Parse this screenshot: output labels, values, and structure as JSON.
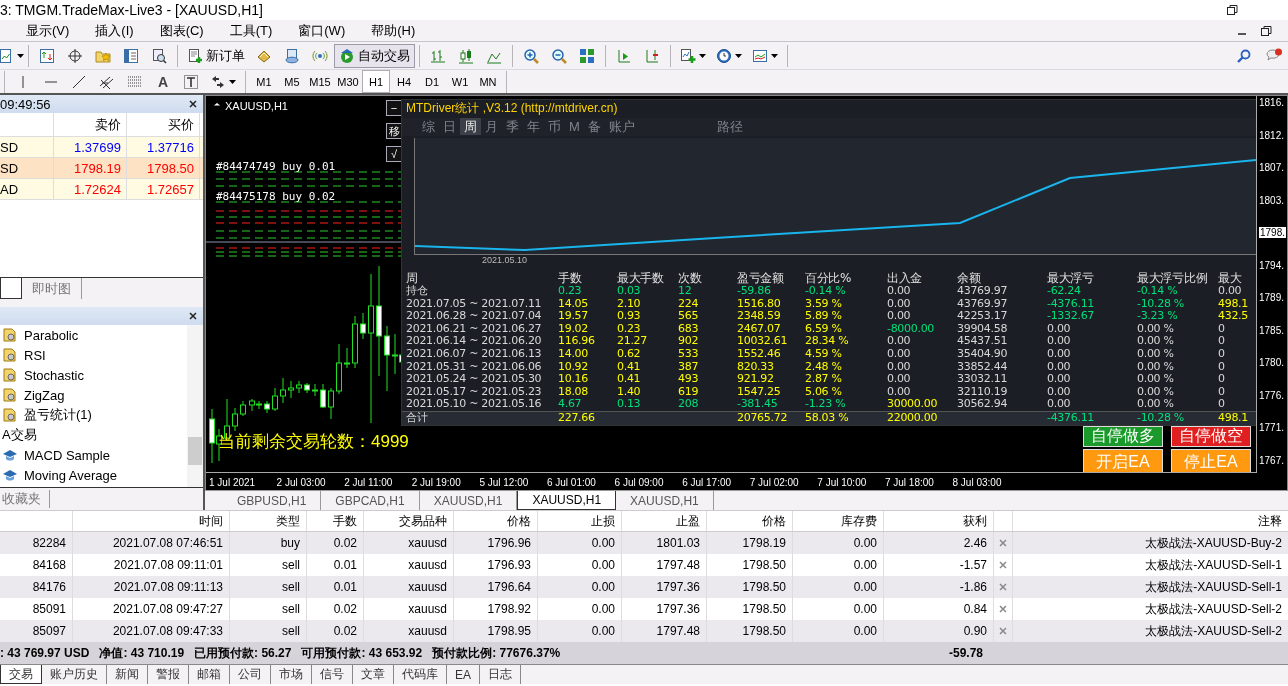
{
  "window": {
    "title": "3: TMGM.TradeMax-Live3 - [XAUUSD,H1]"
  },
  "menu": [
    "显示(V)",
    "插入(I)",
    "图表(C)",
    "工具(T)",
    "窗口(W)",
    "帮助(H)"
  ],
  "toolbar": {
    "buttons": [
      {
        "label": "新订单",
        "on": false
      },
      {
        "label": "自动交易",
        "on": true
      }
    ]
  },
  "drawing_toolbar": {
    "text_tool": "A",
    "timeframes": [
      {
        "label": "M1",
        "selected": false
      },
      {
        "label": "M5",
        "selected": false
      },
      {
        "label": "M15",
        "selected": false
      },
      {
        "label": "M30",
        "selected": false
      },
      {
        "label": "H1",
        "selected": true
      },
      {
        "label": "H4",
        "selected": false
      },
      {
        "label": "D1",
        "selected": false
      },
      {
        "label": "W1",
        "selected": false
      },
      {
        "label": "MN",
        "selected": false
      }
    ]
  },
  "market_watch": {
    "time": "09:49:56",
    "columns": [
      "卖价",
      "买价"
    ],
    "rows": [
      {
        "symbol": "SD",
        "bid": "1.37699",
        "ask": "1.37716",
        "color": "#0000ff",
        "selected": false
      },
      {
        "symbol": "SD",
        "bid": "1798.19",
        "ask": "1798.50",
        "color": "#ff0000",
        "selected": true
      },
      {
        "symbol": "AD",
        "bid": "1.72624",
        "ask": "1.72657",
        "color": "#ff0000",
        "selected": false
      }
    ],
    "tabs": [
      {
        "selected": true
      },
      {
        "label": "即时图",
        "selected": false
      }
    ]
  },
  "navigator": {
    "items": [
      {
        "label": "Parabolic",
        "kind": "indicator"
      },
      {
        "label": "RSI",
        "kind": "indicator"
      },
      {
        "label": "Stochastic",
        "kind": "indicator"
      },
      {
        "label": "ZigZag",
        "kind": "indicator"
      },
      {
        "label": "盈亏统计(1)",
        "kind": "indicator"
      },
      {
        "label": "A交易",
        "kind": "folder",
        "children": [
          {
            "label": "MACD Sample",
            "kind": "expert"
          },
          {
            "label": "Moving Average",
            "kind": "expert"
          }
        ]
      }
    ],
    "bottom_tab": "收藏夹"
  },
  "chart": {
    "symbol": "XAUUSD,H1",
    "side_buttons": [
      "−",
      "移",
      "√"
    ],
    "order_labels": [
      "#84474749 buy 0.01",
      "#84475178 buy 0.02"
    ],
    "rounds_text": "当前剩余交易轮数：4999",
    "ea_buttons": [
      {
        "label": "自停做多",
        "kind": "long"
      },
      {
        "label": "自停做空",
        "kind": "short"
      },
      {
        "label": "开启EA",
        "kind": "start"
      },
      {
        "label": "停止EA",
        "kind": "stop"
      }
    ],
    "time_axis": [
      "1 Jul 2021",
      "2 Jul 03:00",
      "2 Jul 11:00",
      "2 Jul 19:00",
      "5 Jul 12:00",
      "6 Jul 01:00",
      "6 Jul 09:00",
      "6 Jul 17:00",
      "7 Jul 02:00",
      "7 Jul 10:00",
      "7 Jul 18:00",
      "8 Jul 03:00"
    ],
    "price_axis": [
      {
        "text": "1816.",
        "highlighted": false
      },
      {
        "text": "1812.",
        "highlighted": false
      },
      {
        "text": "1807.",
        "highlighted": false
      },
      {
        "text": "1803.",
        "highlighted": false
      },
      {
        "text": "1798.",
        "highlighted": true
      },
      {
        "text": "1794.",
        "highlighted": false
      },
      {
        "text": "1789.",
        "highlighted": false
      },
      {
        "text": "1785.",
        "highlighted": false
      },
      {
        "text": "1780.",
        "highlighted": false
      },
      {
        "text": "1776.",
        "highlighted": false
      },
      {
        "text": "1771.",
        "highlighted": false
      },
      {
        "text": "1767.",
        "highlighted": false
      }
    ],
    "stats_panel": {
      "title": "MTDriver统计 ,V3.12 (http://mtdriver.cn)",
      "tabs": [
        {
          "label": "综",
          "selected": false
        },
        {
          "label": "日",
          "selected": false
        },
        {
          "label": "周",
          "selected": true
        },
        {
          "label": "月",
          "selected": false
        },
        {
          "label": "季",
          "selected": false
        },
        {
          "label": "年",
          "selected": false
        },
        {
          "label": "币",
          "selected": false
        },
        {
          "label": "M",
          "selected": false
        },
        {
          "label": "备",
          "selected": false
        },
        {
          "label": "账户",
          "selected": false
        },
        {
          "label": "路径",
          "selected": false
        }
      ],
      "equity_chart": {
        "date_label": "2021.05.10"
      },
      "columns": [
        "周",
        "手数",
        "最大手数",
        "次数",
        "盈亏金额",
        "百分比%",
        "出入金",
        "余额",
        "最大浮亏",
        "最大浮亏比例",
        "最大"
      ],
      "rows": [
        {
          "cells": [
            {
              "text": "持仓"
            },
            {
              "text": "0.23",
              "color": "#00e07a"
            },
            {
              "text": "0.03",
              "color": "#00e07a"
            },
            {
              "text": "12",
              "color": "#00e07a"
            },
            {
              "text": "-59.86",
              "color": "#00e07a"
            },
            {
              "text": "-0.14 %",
              "color": "#00e07a"
            },
            {
              "text": "0.00",
              "color": "#d8d8d8"
            },
            {
              "text": "43769.97",
              "color": "#d8d8d8"
            },
            {
              "text": "-62.24",
              "color": "#00e07a"
            },
            {
              "text": "-0.14 %",
              "color": "#00e07a"
            },
            {
              "text": "0.00",
              "color": "#d8d8d8"
            }
          ]
        },
        {
          "cells": [
            {
              "text": "2021.07.05 ~ 2021.07.11",
              "color": "#d8d8d8"
            },
            {
              "text": "14.05",
              "color": "#ffff00"
            },
            {
              "text": "2.10",
              "color": "#ffff00"
            },
            {
              "text": "224",
              "color": "#ffff00"
            },
            {
              "text": "1516.80",
              "color": "#ffff00"
            },
            {
              "text": "3.59 %",
              "color": "#ffff00"
            },
            {
              "text": "0.00",
              "color": "#d8d8d8"
            },
            {
              "text": "43769.97",
              "color": "#d8d8d8"
            },
            {
              "text": "-4376.11",
              "color": "#00e07a"
            },
            {
              "text": "-10.28 %",
              "color": "#00e07a"
            },
            {
              "text": "498.1",
              "color": "#ffff00"
            }
          ]
        },
        {
          "cells": [
            {
              "text": "2021.06.28 ~ 2021.07.04",
              "color": "#d8d8d8"
            },
            {
              "text": "19.57",
              "color": "#ffff00"
            },
            {
              "text": "0.93",
              "color": "#ffff00"
            },
            {
              "text": "565",
              "color": "#ffff00"
            },
            {
              "text": "2348.59",
              "color": "#ffff00"
            },
            {
              "text": "5.89 %",
              "color": "#ffff00"
            },
            {
              "text": "0.00",
              "color": "#d8d8d8"
            },
            {
              "text": "42253.17",
              "color": "#d8d8d8"
            },
            {
              "text": "-1332.67",
              "color": "#00e07a"
            },
            {
              "text": "-3.23 %",
              "color": "#00e07a"
            },
            {
              "text": "432.5",
              "color": "#ffff00"
            }
          ]
        },
        {
          "cells": [
            {
              "text": "2021.06.21 ~ 2021.06.27",
              "color": "#d8d8d8"
            },
            {
              "text": "19.02",
              "color": "#ffff00"
            },
            {
              "text": "0.23",
              "color": "#ffff00"
            },
            {
              "text": "683",
              "color": "#ffff00"
            },
            {
              "text": "2467.07",
              "color": "#ffff00"
            },
            {
              "text": "6.59 %",
              "color": "#ffff00"
            },
            {
              "text": "-8000.00",
              "color": "#00e07a"
            },
            {
              "text": "39904.58",
              "color": "#d8d8d8"
            },
            {
              "text": "0.00",
              "color": "#d8d8d8"
            },
            {
              "text": "0.00 %",
              "color": "#d8d8d8"
            },
            {
              "text": "0",
              "color": "#d8d8d8"
            }
          ]
        },
        {
          "cells": [
            {
              "text": "2021.06.14 ~ 2021.06.20",
              "color": "#d8d8d8"
            },
            {
              "text": "116.96",
              "color": "#ffff00"
            },
            {
              "text": "21.27",
              "color": "#ffff00"
            },
            {
              "text": "902",
              "color": "#ffff00"
            },
            {
              "text": "10032.61",
              "color": "#ffff00"
            },
            {
              "text": "28.34 %",
              "color": "#ffff00"
            },
            {
              "text": "0.00",
              "color": "#d8d8d8"
            },
            {
              "text": "45437.51",
              "color": "#d8d8d8"
            },
            {
              "text": "0.00",
              "color": "#d8d8d8"
            },
            {
              "text": "0.00 %",
              "color": "#d8d8d8"
            },
            {
              "text": "0",
              "color": "#d8d8d8"
            }
          ]
        },
        {
          "cells": [
            {
              "text": "2021.06.07 ~ 2021.06.13",
              "color": "#d8d8d8"
            },
            {
              "text": "14.00",
              "color": "#ffff00"
            },
            {
              "text": "0.62",
              "color": "#ffff00"
            },
            {
              "text": "533",
              "color": "#ffff00"
            },
            {
              "text": "1552.46",
              "color": "#ffff00"
            },
            {
              "text": "4.59 %",
              "color": "#ffff00"
            },
            {
              "text": "0.00",
              "color": "#d8d8d8"
            },
            {
              "text": "35404.90",
              "color": "#d8d8d8"
            },
            {
              "text": "0.00",
              "color": "#d8d8d8"
            },
            {
              "text": "0.00 %",
              "color": "#d8d8d8"
            },
            {
              "text": "0",
              "color": "#d8d8d8"
            }
          ]
        },
        {
          "cells": [
            {
              "text": "2021.05.31 ~ 2021.06.06",
              "color": "#d8d8d8"
            },
            {
              "text": "10.92",
              "color": "#ffff00"
            },
            {
              "text": "0.41",
              "color": "#ffff00"
            },
            {
              "text": "387",
              "color": "#ffff00"
            },
            {
              "text": "820.33",
              "color": "#ffff00"
            },
            {
              "text": "2.48 %",
              "color": "#ffff00"
            },
            {
              "text": "0.00",
              "color": "#d8d8d8"
            },
            {
              "text": "33852.44",
              "color": "#d8d8d8"
            },
            {
              "text": "0.00",
              "color": "#d8d8d8"
            },
            {
              "text": "0.00 %",
              "color": "#d8d8d8"
            },
            {
              "text": "0",
              "color": "#d8d8d8"
            }
          ]
        },
        {
          "cells": [
            {
              "text": "2021.05.24 ~ 2021.05.30",
              "color": "#d8d8d8"
            },
            {
              "text": "10.16",
              "color": "#ffff00"
            },
            {
              "text": "0.41",
              "color": "#ffff00"
            },
            {
              "text": "493",
              "color": "#ffff00"
            },
            {
              "text": "921.92",
              "color": "#ffff00"
            },
            {
              "text": "2.87 %",
              "color": "#ffff00"
            },
            {
              "text": "0.00",
              "color": "#d8d8d8"
            },
            {
              "text": "33032.11",
              "color": "#d8d8d8"
            },
            {
              "text": "0.00",
              "color": "#d8d8d8"
            },
            {
              "text": "0.00 %",
              "color": "#d8d8d8"
            },
            {
              "text": "0",
              "color": "#d8d8d8"
            }
          ]
        },
        {
          "cells": [
            {
              "text": "2021.05.17 ~ 2021.05.23",
              "color": "#d8d8d8"
            },
            {
              "text": "18.08",
              "color": "#ffff00"
            },
            {
              "text": "1.40",
              "color": "#ffff00"
            },
            {
              "text": "619",
              "color": "#ffff00"
            },
            {
              "text": "1547.25",
              "color": "#ffff00"
            },
            {
              "text": "5.06 %",
              "color": "#ffff00"
            },
            {
              "text": "0.00",
              "color": "#d8d8d8"
            },
            {
              "text": "32110.19",
              "color": "#d8d8d8"
            },
            {
              "text": "0.00",
              "color": "#d8d8d8"
            },
            {
              "text": "0.00 %",
              "color": "#d8d8d8"
            },
            {
              "text": "0",
              "color": "#d8d8d8"
            }
          ]
        },
        {
          "cells": [
            {
              "text": "2021.05.10 ~ 2021.05.16",
              "color": "#d8d8d8"
            },
            {
              "text": "4.67",
              "color": "#00e07a"
            },
            {
              "text": "0.13",
              "color": "#00e07a"
            },
            {
              "text": "208",
              "color": "#00e07a"
            },
            {
              "text": "-381.45",
              "color": "#00e07a"
            },
            {
              "text": "-1.23 %",
              "color": "#00e07a"
            },
            {
              "text": "30000.00",
              "color": "#ffff00"
            },
            {
              "text": "30562.94",
              "color": "#d8d8d8"
            },
            {
              "text": "0.00",
              "color": "#d8d8d8"
            },
            {
              "text": "0.00 %",
              "color": "#d8d8d8"
            },
            {
              "text": "0",
              "color": "#d8d8d8"
            }
          ]
        }
      ],
      "total": {
        "cells": [
          {
            "text": "合计"
          },
          {
            "text": "227.66",
            "color": "#ffff00"
          },
          null,
          null,
          {
            "text": "20765.72",
            "color": "#ffff00"
          },
          {
            "text": "58.03 %",
            "color": "#ffff00"
          },
          {
            "text": "22000.00",
            "color": "#ffff00"
          },
          null,
          {
            "text": "-4376.11",
            "color": "#00e07a"
          },
          {
            "text": "-10.28 %",
            "color": "#00e07a"
          },
          {
            "text": "498.1",
            "color": "#ffff00"
          }
        ]
      }
    }
  },
  "chart_tabs": [
    {
      "label": "GBPUSD,H1",
      "selected": false
    },
    {
      "label": "GBPCAD,H1",
      "selected": false
    },
    {
      "label": "XAUUSD,H1",
      "selected": false
    },
    {
      "label": "XAUUSD,H1",
      "selected": true
    },
    {
      "label": "XAUUSD,H1",
      "selected": false
    }
  ],
  "trades": {
    "columns": [
      "时间",
      "类型",
      "手数",
      "交易品种",
      "价格",
      "止损",
      "止盈",
      "价格",
      "库存费",
      "获利",
      "注释"
    ],
    "rows": [
      {
        "order": "82284",
        "cells": [
          "2021.07.08 07:46:51",
          "buy",
          "0.02",
          "xauusd",
          "1796.96",
          "0.00",
          "1801.03",
          "1798.19",
          "0.00",
          "2.46"
        ],
        "comment": "太极战法-XAUUSD-Buy-2"
      },
      {
        "order": "84168",
        "cells": [
          "2021.07.08 09:11:01",
          "sell",
          "0.01",
          "xauusd",
          "1796.93",
          "0.00",
          "1797.48",
          "1798.50",
          "0.00",
          "-1.57"
        ],
        "comment": "太极战法-XAUUSD-Sell-1"
      },
      {
        "order": "84176",
        "cells": [
          "2021.07.08 09:11:13",
          "sell",
          "0.01",
          "xauusd",
          "1796.64",
          "0.00",
          "1797.36",
          "1798.50",
          "0.00",
          "-1.86"
        ],
        "comment": "太极战法-XAUUSD-Sell-1"
      },
      {
        "order": "85091",
        "cells": [
          "2021.07.08 09:47:27",
          "sell",
          "0.02",
          "xauusd",
          "1798.92",
          "0.00",
          "1797.36",
          "1798.50",
          "0.00",
          "0.84"
        ],
        "comment": "太极战法-XAUUSD-Sell-2"
      },
      {
        "order": "85097",
        "cells": [
          "2021.07.08 09:47:33",
          "sell",
          "0.02",
          "xauusd",
          "1798.95",
          "0.00",
          "1797.48",
          "1798.50",
          "0.00",
          "0.90"
        ],
        "comment": "太极战法-XAUUSD-Sell-2"
      }
    ],
    "summary": {
      "items": [
        ": 43 769.97 USD",
        "净值: 43 710.19",
        "已用预付款: 56.27",
        "可用预付款: 43 653.92",
        "预付款比例: 77676.37%"
      ],
      "profit": "-59.78"
    }
  },
  "bottom_tabs": [
    {
      "label": "交易",
      "selected": true
    },
    {
      "label": "账户历史",
      "selected": false
    },
    {
      "label": "新闻",
      "selected": false
    },
    {
      "label": "警报",
      "selected": false
    },
    {
      "label": "邮箱",
      "selected": false
    },
    {
      "label": "公司",
      "selected": false
    },
    {
      "label": "市场",
      "selected": false
    },
    {
      "label": "信号",
      "selected": false
    },
    {
      "label": "文章",
      "selected": false
    },
    {
      "label": "代码库",
      "selected": false
    },
    {
      "label": "EA",
      "selected": false
    },
    {
      "label": "日志",
      "selected": false
    }
  ]
}
